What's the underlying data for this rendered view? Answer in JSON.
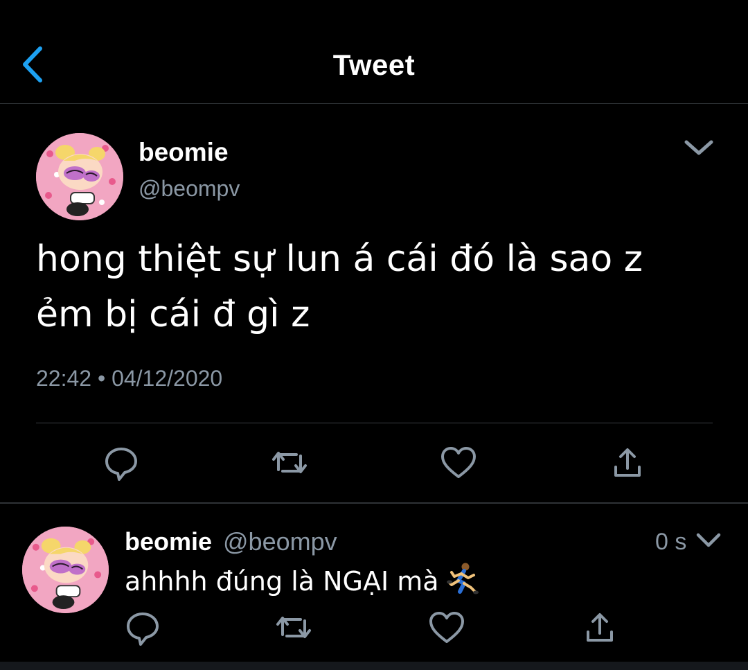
{
  "header": {
    "title": "Tweet",
    "back_icon": "chevron-left-icon",
    "accent_color": "#1da1f2"
  },
  "tweet": {
    "display_name": "beomie",
    "handle": "@beompv",
    "text_lines": [
      "hong thiệt sự lun á cái đó là sao z",
      "ẻm bị cái đ gì z"
    ],
    "timestamp": "22:42 • 04/12/2020",
    "actions": [
      "reply-icon",
      "retweet-icon",
      "like-icon",
      "share-icon"
    ]
  },
  "reply": {
    "display_name": "beomie",
    "handle": "@beompv",
    "time": "0 s",
    "text": "ahhhh đúng là NGẠI mà",
    "emoji": "running-person-icon",
    "actions": [
      "reply-icon",
      "retweet-icon",
      "like-icon",
      "share-icon"
    ]
  },
  "colors": {
    "background": "#000000",
    "text_primary": "#ffffff",
    "text_secondary": "#8b98a5",
    "divider": "#2f3336"
  }
}
